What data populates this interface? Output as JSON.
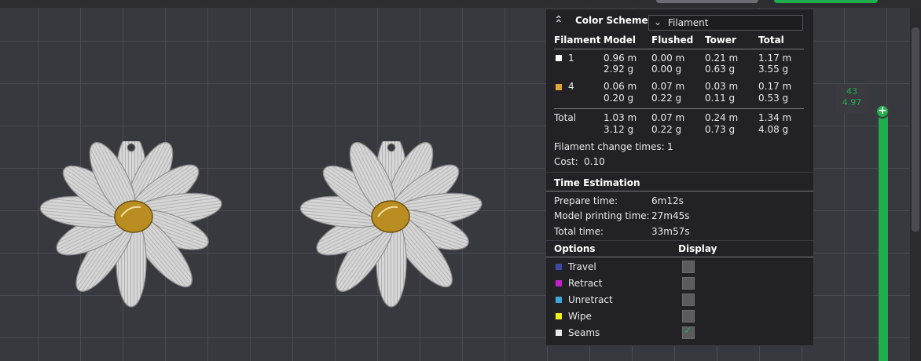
{
  "color_scheme": {
    "label": "Color Scheme",
    "selected": "Filament"
  },
  "filament_table": {
    "headers": [
      "Filament",
      "Model",
      "Flushed",
      "Tower",
      "Total"
    ],
    "rows": [
      {
        "id": "1",
        "color": "#ffffff",
        "model": [
          "0.96 m",
          "2.92 g"
        ],
        "flushed": [
          "0.00 m",
          "0.00 g"
        ],
        "tower": [
          "0.21 m",
          "0.63 g"
        ],
        "total": [
          "1.17 m",
          "3.55 g"
        ]
      },
      {
        "id": "4",
        "color": "#e0a43a",
        "model": [
          "0.06 m",
          "0.20 g"
        ],
        "flushed": [
          "0.07 m",
          "0.22 g"
        ],
        "tower": [
          "0.03 m",
          "0.11 g"
        ],
        "total": [
          "0.17 m",
          "0.53 g"
        ]
      }
    ],
    "total_row": {
      "label": "Total",
      "model": [
        "1.03 m",
        "3.12 g"
      ],
      "flushed": [
        "0.07 m",
        "0.22 g"
      ],
      "tower": [
        "0.24 m",
        "0.73 g"
      ],
      "total": [
        "1.34 m",
        "4.08 g"
      ]
    }
  },
  "filament_change": {
    "label": "Filament change times:",
    "value": "1"
  },
  "cost": {
    "label": "Cost:",
    "value": "0.10"
  },
  "time_estimation": {
    "title": "Time Estimation",
    "prepare": {
      "label": "Prepare time:",
      "value": "6m12s"
    },
    "model_printing": {
      "label": "Model printing time:",
      "value": "27m45s"
    },
    "total": {
      "label": "Total time:",
      "value": "33m57s"
    }
  },
  "options": {
    "header_options": "Options",
    "header_display": "Display",
    "items": [
      {
        "label": "Travel",
        "color": "#3a4aa8",
        "checked": false
      },
      {
        "label": "Retract",
        "color": "#c21fc8",
        "checked": false
      },
      {
        "label": "Unretract",
        "color": "#3ea6d8",
        "checked": false
      },
      {
        "label": "Wipe",
        "color": "#f4ef1a",
        "checked": false
      },
      {
        "label": "Seams",
        "color": "#e8e8e8",
        "checked": true
      }
    ]
  },
  "layer_slider": {
    "layer": "43",
    "height": "4.97"
  },
  "icons": {
    "collapse": "double-chevron-up-icon",
    "dropdown": "chevron-down-icon",
    "add": "plus-icon"
  },
  "accent_color": "#1fae4b"
}
